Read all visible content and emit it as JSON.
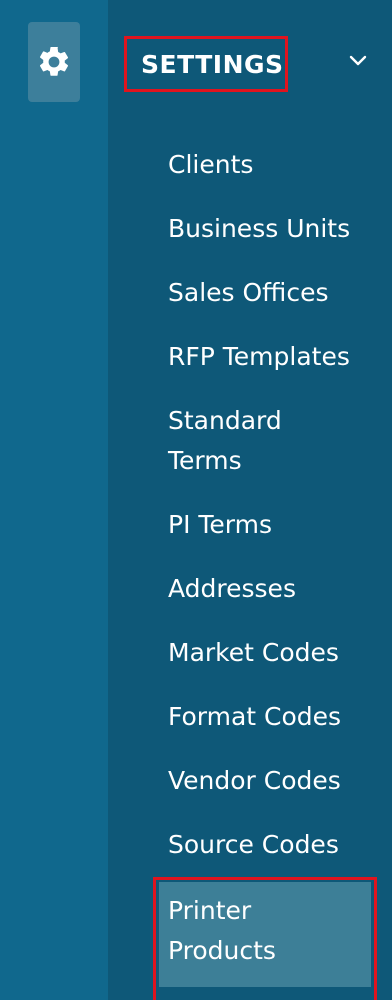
{
  "rail": {
    "gear_icon": "gear-icon"
  },
  "settings": {
    "title": "SETTINGS",
    "chevron_icon": "chevron-down-icon"
  },
  "menu": {
    "items": [
      {
        "label": "Clients"
      },
      {
        "label": "Business Units"
      },
      {
        "label": "Sales Offices"
      },
      {
        "label": "RFP Templates"
      },
      {
        "label": "Standard Terms"
      },
      {
        "label": "PI Terms"
      },
      {
        "label": "Addresses"
      },
      {
        "label": "Market Codes"
      },
      {
        "label": "Format Codes"
      },
      {
        "label": "Vendor Codes"
      },
      {
        "label": "Source Codes"
      },
      {
        "label": "Printer Products"
      }
    ],
    "active_index": 11
  },
  "colors": {
    "background": "#0e5878",
    "rail": "#10688d",
    "active_bg": "#3d7f97",
    "highlight_border": "#e0141e",
    "text": "#ffffff"
  }
}
